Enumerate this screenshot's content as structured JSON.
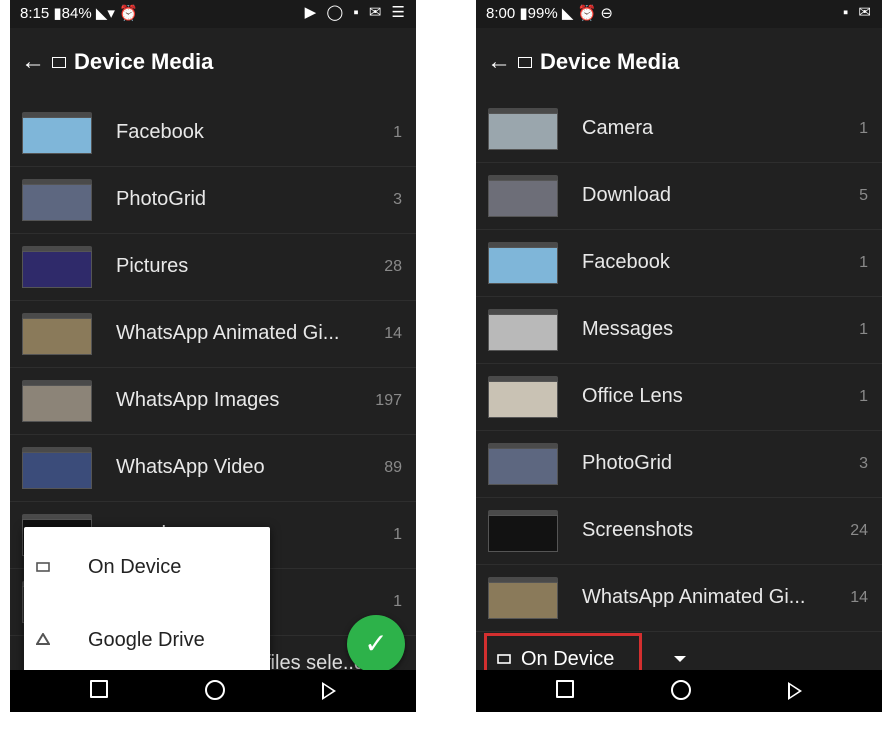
{
  "left": {
    "status": {
      "time": "8:15",
      "battery": "84%"
    },
    "app_bar": {
      "title": "Device Media"
    },
    "items": [
      {
        "label": "Facebook",
        "count": "1",
        "thumb": "#7fb6d9"
      },
      {
        "label": "PhotoGrid",
        "count": "3",
        "thumb": "#5d6780"
      },
      {
        "label": "Pictures",
        "count": "28",
        "thumb": "#2f2a6a"
      },
      {
        "label": "WhatsApp Animated Gi...",
        "count": "14",
        "thumb": "#8a7a5a"
      },
      {
        "label": "WhatsApp Images",
        "count": "197",
        "thumb": "#8c8478"
      },
      {
        "label": "WhatsApp Video",
        "count": "89",
        "thumb": "#3b4c7a"
      },
      {
        "label": "...oader",
        "count": "1",
        "thumb": "#111111"
      },
      {
        "label": "",
        "count": "1",
        "thumb": "#333333"
      }
    ],
    "popup": {
      "on_device": "On Device",
      "google_drive": "Google Drive"
    },
    "bottom_text": "files sele..d"
  },
  "right": {
    "status": {
      "time": "8:00",
      "battery": "99%"
    },
    "app_bar": {
      "title": "Device Media"
    },
    "items": [
      {
        "label": "Camera",
        "count": "1",
        "thumb": "#9aa6ad"
      },
      {
        "label": "Download",
        "count": "5",
        "thumb": "#6d6e78"
      },
      {
        "label": "Facebook",
        "count": "1",
        "thumb": "#7fb6d9"
      },
      {
        "label": "Messages",
        "count": "1",
        "thumb": "#b9b9b9"
      },
      {
        "label": "Office Lens",
        "count": "1",
        "thumb": "#c9c2b4"
      },
      {
        "label": "PhotoGrid",
        "count": "3",
        "thumb": "#5d6780"
      },
      {
        "label": "Screenshots",
        "count": "24",
        "thumb": "#121212"
      },
      {
        "label": "WhatsApp Animated Gi...",
        "count": "14",
        "thumb": "#8a7a5a"
      }
    ],
    "source_selector": "On Device"
  },
  "colors": {
    "background": "#212121",
    "fab": "#2db24a",
    "highlight": "#d32f2f"
  }
}
